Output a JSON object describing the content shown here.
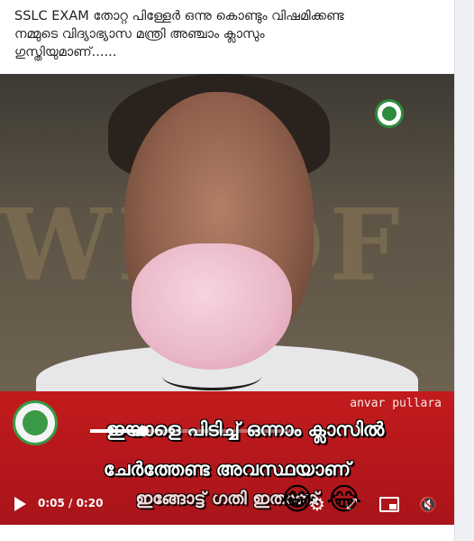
{
  "post": {
    "line1": "SSLC EXAM തോറ്റ പിള്ളേർ ഒന്നു കൊണ്ടും വിഷമിക്കണ്ട",
    "line2": "നമ്മുടെ വിദ്യാഭ്യാസ മന്ത്രി അഞ്ചാം ക്ലാസും",
    "line3": "ഗുസ്തിയുമാണ്......"
  },
  "video": {
    "wall_text": "WE OF",
    "credit": "anvar pullara",
    "caption_line1": "ഇയാളെ പിടിച്ച് ഒന്നാം ക്ലാസിൽ",
    "caption_line2": "ചേർത്തേണ്ട അവസ്ഥയാണ്",
    "caption_line3": "ഇങ്ങോട്ട് ഗതി ഇതാണ്",
    "emoji_1": "😂",
    "emoji_2": "😂",
    "time": "0:05 / 0:20",
    "progress_fraction": 0.25,
    "settings_icon": "⚙",
    "fullscreen_icon": "⤢",
    "mute_icon": "🔇"
  },
  "colors": {
    "caption_band": "#c21b1d",
    "logo_green": "#2e8b3c"
  }
}
